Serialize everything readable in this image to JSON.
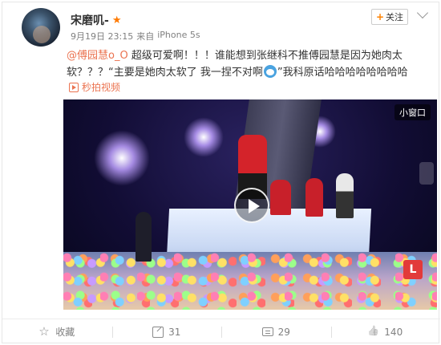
{
  "post": {
    "username": "宋磨叽-",
    "follow_label": "关注",
    "date": "9月19日 23:15",
    "source_prefix": "来自",
    "source": "iPhone 5s",
    "mention": "@傅园慧o_O",
    "text_part1": " 超级可爱啊！！！谁能想到张继科不推傅园慧是因为她肉太软？？？“主要是她肉太软了 我一捏不对啊",
    "text_part2": "”我科原话哈哈哈哈哈哈哈哈",
    "video_link_label": "秒拍视频"
  },
  "video": {
    "mini_window_label": "小窗口",
    "logo_text": "L"
  },
  "footer": {
    "favorite_label": "收藏",
    "share_count": "31",
    "comment_count": "29",
    "like_count": "140"
  },
  "colors": {
    "link": "#eb7350",
    "accent": "#ff8200"
  },
  "icons": [
    "vip-star-icon",
    "plus-icon",
    "chevron-down-icon",
    "emoji-icon",
    "play-icon",
    "star-icon",
    "share-icon",
    "comment-icon",
    "like-icon"
  ]
}
